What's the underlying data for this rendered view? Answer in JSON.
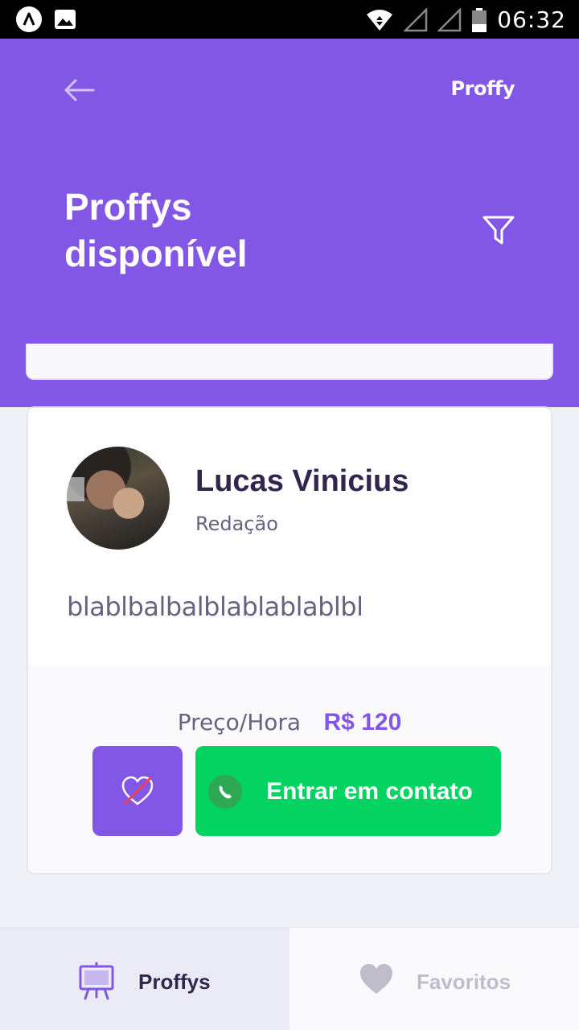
{
  "status_bar": {
    "time": "06:32",
    "icons": [
      "app-notification-icon",
      "image-notification-icon",
      "wifi-icon",
      "signal-icon",
      "signal-icon",
      "battery-icon"
    ]
  },
  "header": {
    "brand": "Proffy",
    "title": "Proffys disponível",
    "back_icon": "arrow-left-icon",
    "filter_icon": "filter-icon",
    "background": "#8257e5"
  },
  "teacher_card": {
    "name": "Lucas Vinicius",
    "subject": "Redação",
    "bio": "blablbalbalblablablablbl",
    "price_label": "Preço/Hora",
    "price_value": "R$ 120",
    "contact_label": "Entrar em contato",
    "favorite_icon": "heart-outline-crossed-icon",
    "contact_icon": "whatsapp-icon",
    "colors": {
      "primary": "#8257e5",
      "contact": "#04d361",
      "title": "#32264d",
      "text": "#6a6180"
    }
  },
  "tabs": [
    {
      "label": "Proffys",
      "icon": "easel-icon",
      "active": true
    },
    {
      "label": "Favoritos",
      "icon": "heart-icon",
      "active": false
    }
  ]
}
